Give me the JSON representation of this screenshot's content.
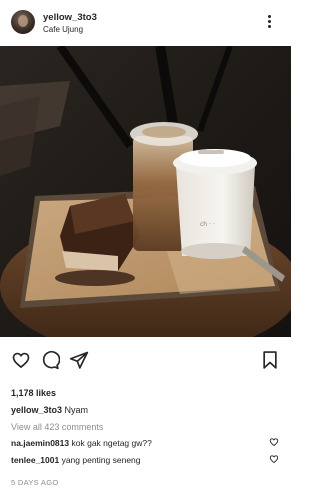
{
  "post": {
    "username": "yellow_3to3",
    "location": "Cafe Ujung",
    "likes": "1,178 likes",
    "caption_user": "yellow_3to3",
    "caption_text": "Nyam",
    "view_all": "View all 423 comments",
    "timestamp": "5 DAYS AGO"
  },
  "comments": [
    {
      "user": "na.jaemin0813",
      "text": "kok gak ngetag gw??"
    },
    {
      "user": "tenlee_1001",
      "text": "yang penting seneng"
    }
  ],
  "icons": {
    "more": "more-options-icon",
    "like": "heart-icon",
    "comment": "comment-icon",
    "share": "share-icon",
    "save": "bookmark-icon"
  }
}
